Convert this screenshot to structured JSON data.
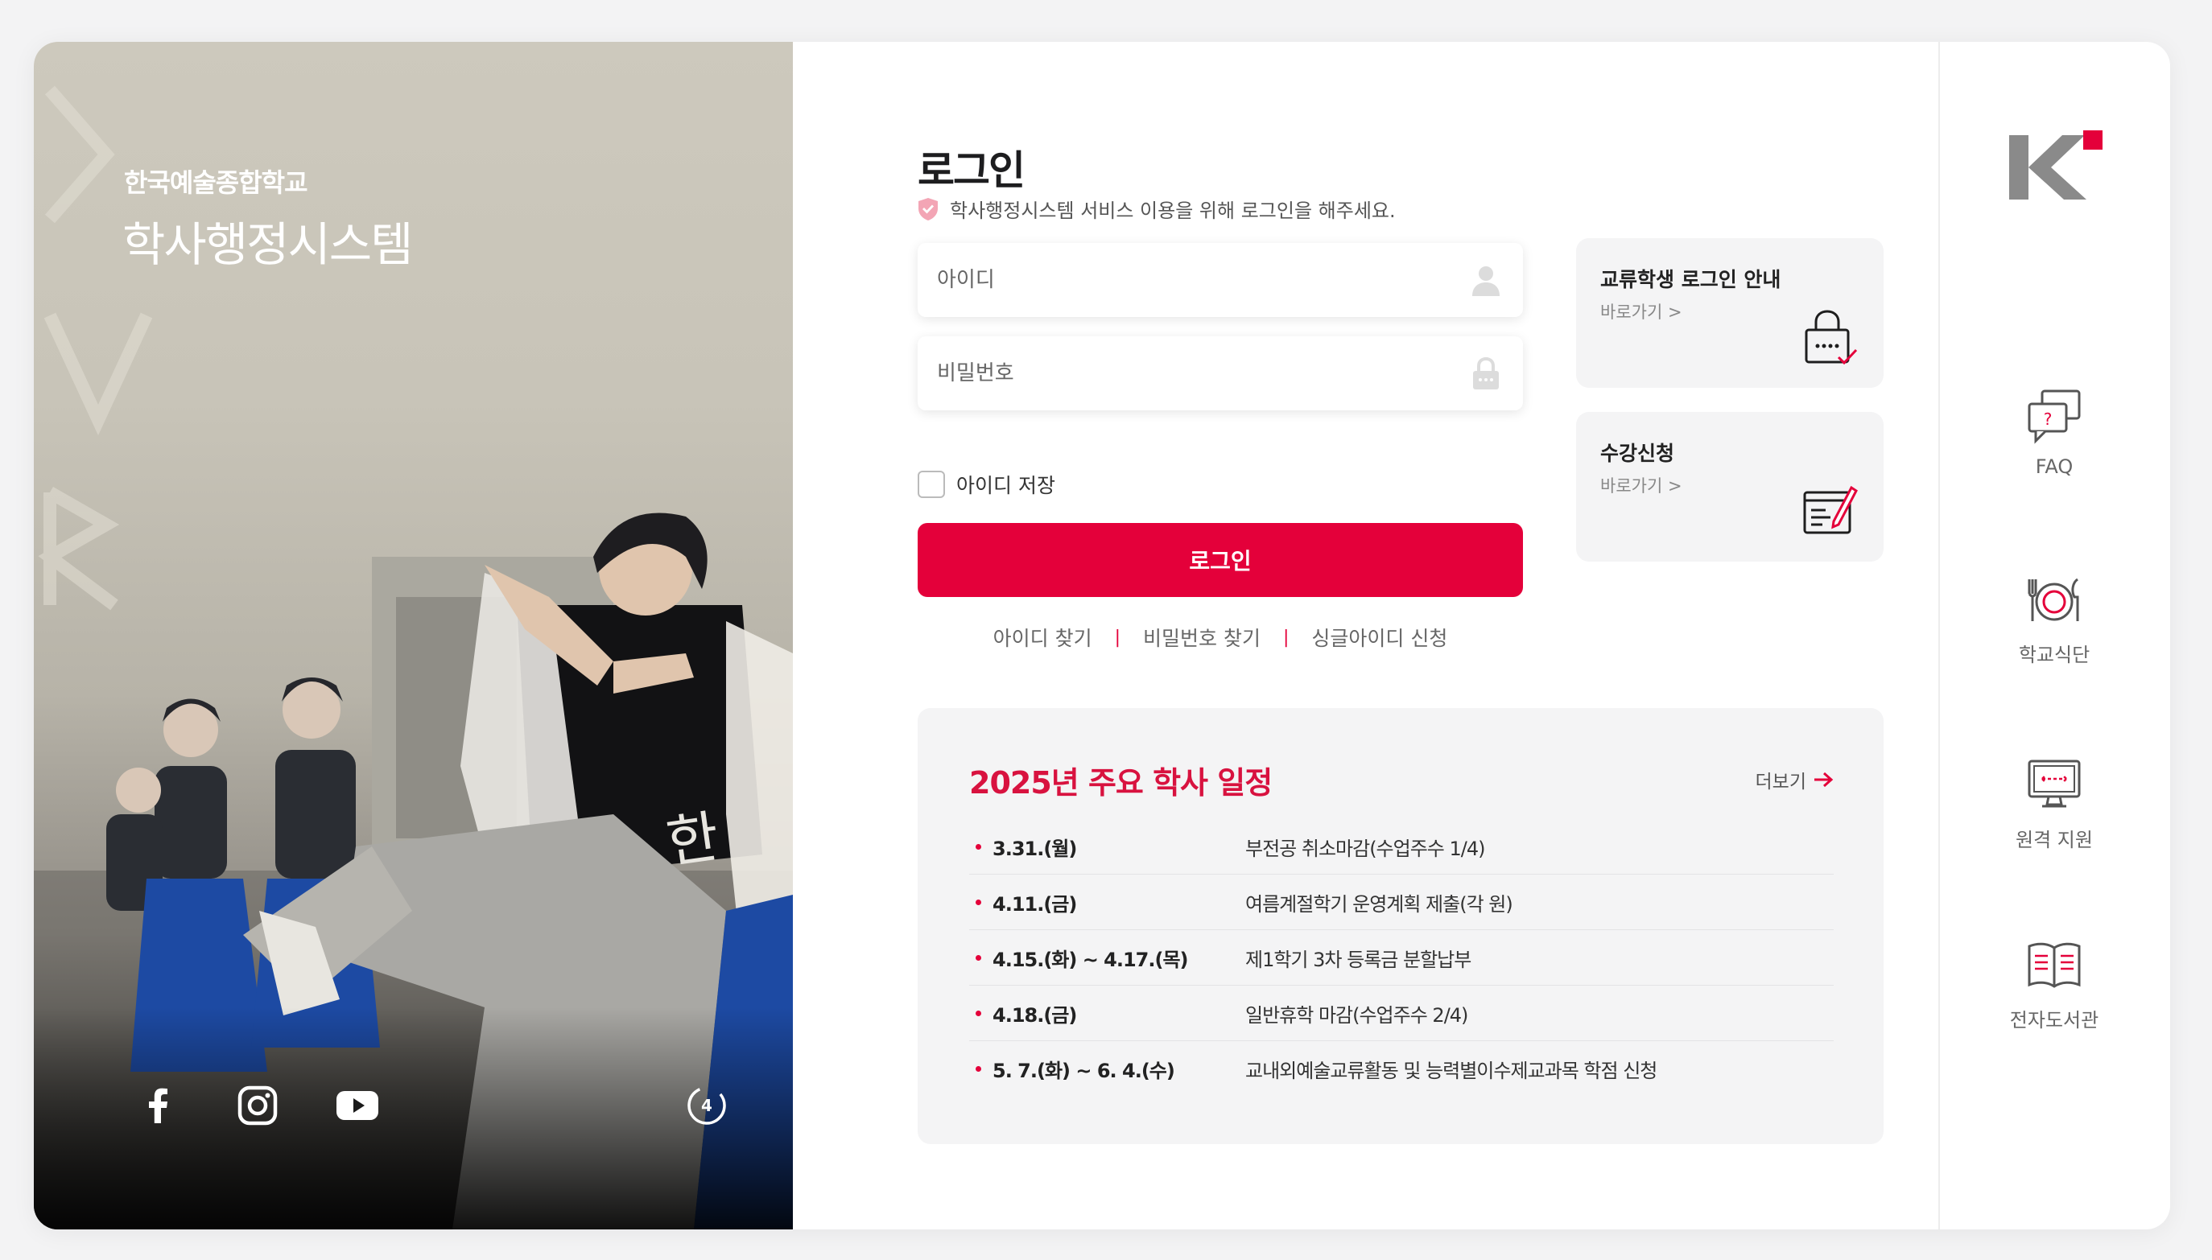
{
  "hero": {
    "school_name": "한국예술종합학교",
    "system_name": "학사행정시스템",
    "social": [
      "facebook-icon",
      "instagram-icon",
      "youtube-icon",
      "k-arts-channel-icon"
    ],
    "social_badge": "4"
  },
  "login": {
    "title": "로그인",
    "subtitle": "학사행정시스템 서비스 이용을 위해 로그인을 해주세요.",
    "id_placeholder": "아이디",
    "password_placeholder": "비밀번호",
    "remember_label": "아이디 저장",
    "submit_label": "로그인",
    "links": [
      "아이디 찾기",
      "비밀번호 찾기",
      "싱글아이디 신청"
    ],
    "separator": "|"
  },
  "quick_cards": [
    {
      "title": "교류학생 로그인 안내",
      "link": "바로가기 >",
      "icon": "lock-check-icon"
    },
    {
      "title": "수강신청",
      "link": "바로가기 >",
      "icon": "document-edit-icon"
    }
  ],
  "schedule": {
    "title": "2025년 주요 학사 일정",
    "more_label": "더보기",
    "items": [
      {
        "date": "3.31.(월)",
        "desc": "부전공 취소마감(수업주수 1/4)"
      },
      {
        "date": "4.11.(금)",
        "desc": "여름계절학기 운영계획 제출(각 원)"
      },
      {
        "date": "4.15.(화) ~ 4.17.(목)",
        "desc": "제1학기 3차 등록금 분할납부"
      },
      {
        "date": "4.18.(금)",
        "desc": "일반휴학 마감(수업주수 2/4)"
      },
      {
        "date": "5. 7.(화) ~ 6. 4.(수)",
        "desc": "교내외예술교류활동 및 능력별이수제교과목 학점 신청"
      }
    ]
  },
  "sidebar": {
    "items": [
      {
        "label": "FAQ",
        "icon": "faq-chat-icon"
      },
      {
        "label": "학교식단",
        "icon": "meal-plate-icon"
      },
      {
        "label": "원격 지원",
        "icon": "remote-monitor-icon"
      },
      {
        "label": "전자도서관",
        "icon": "open-book-icon"
      }
    ]
  },
  "colors": {
    "accent": "#e4003a",
    "schedule_title": "#d8123f",
    "card_bg": "#f4f4f5"
  }
}
